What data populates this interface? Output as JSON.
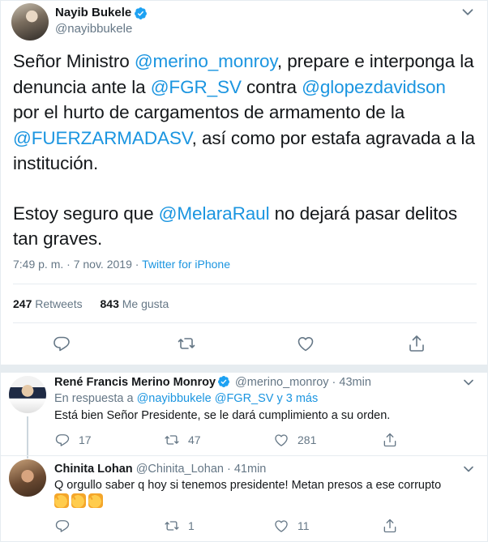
{
  "main_tweet": {
    "author_name": "Nayib Bukele",
    "author_handle": "@nayibbukele",
    "text": {
      "p1_s1": "Señor Ministro ",
      "p1_m1": "@merino_monroy",
      "p1_s2": ", prepare e interponga la denuncia ante la ",
      "p1_m2": "@FGR_SV",
      "p1_s3": " contra ",
      "p1_m3": "@glopezdavidson",
      "p1_s4": " por el hurto de cargamentos de armamento de la ",
      "p1_m4": "@FUERZARMADASV",
      "p1_s5": ", así como por estafa agravada a la institución.",
      "p2_s1": "Estoy seguro que ",
      "p2_m1": "@MelaraRaul",
      "p2_s2": " no dejará pasar delitos tan graves."
    },
    "time": "7:49 p. m.",
    "dot": "·",
    "date": "7 nov. 2019",
    "source": "Twitter for iPhone",
    "retweets_count": "247",
    "retweets_label": "Retweets",
    "likes_count": "843",
    "likes_label": "Me gusta"
  },
  "replies": [
    {
      "author_name": "René Francis Merino Monroy",
      "author_handle": "@merino_monroy",
      "dot": "·",
      "time_ago": "43min",
      "in_reply_prefix": "En respuesta a ",
      "in_reply_targets": "@nayibbukele @FGR_SV y 3 más",
      "text": "Está bien Señor Presidente, se le dará cumplimiento a su orden.",
      "reply_count": "17",
      "retweet_count": "47",
      "like_count": "281"
    },
    {
      "author_name": "Chinita Lohan",
      "author_handle": "@Chinita_Lohan",
      "dot": "·",
      "time_ago": "41min",
      "text": "Q orgullo saber q hoy si tenemos presidente! Metan presos a ese corrupto",
      "emoji": "clapping-hands x3",
      "reply_count": "",
      "retweet_count": "1",
      "like_count": "11"
    }
  ],
  "colors": {
    "link_blue": "#1b95e0",
    "gray_text": "#657786",
    "verified_blue": "#1da1f2",
    "divider": "#e6ecf0"
  },
  "icons": [
    "verified-badge-icon",
    "chevron-down-icon",
    "reply-icon",
    "retweet-icon",
    "like-icon",
    "share-icon",
    "clapping-hands-emoji"
  ]
}
